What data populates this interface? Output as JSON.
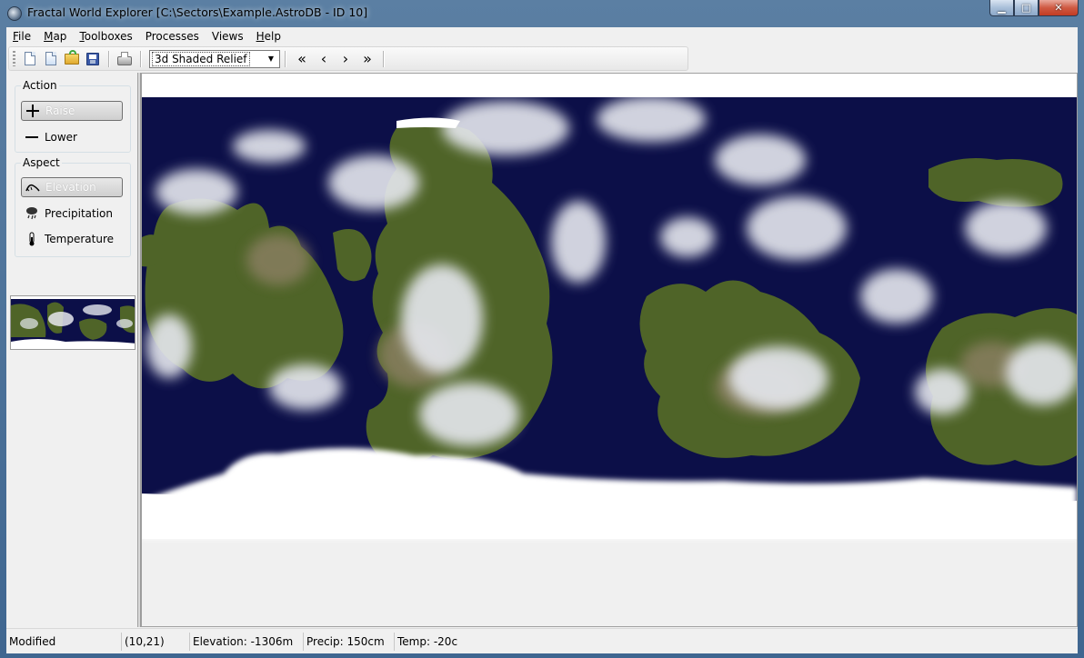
{
  "window": {
    "title": "Fractal World Explorer [C:\\Sectors\\Example.AstroDB - ID 10]",
    "controls": {
      "minimize": "▁",
      "maximize": "□",
      "close": "✕"
    }
  },
  "menu": {
    "items": [
      {
        "key": "F",
        "rest": "ile"
      },
      {
        "key": "M",
        "rest": "ap"
      },
      {
        "key": "T",
        "rest": "oolboxes"
      },
      {
        "key": "",
        "rest": "Processes"
      },
      {
        "key": "",
        "rest": "Views"
      },
      {
        "key": "H",
        "rest": "elp"
      }
    ]
  },
  "toolbar": {
    "view_select": {
      "value": "3d Shaded Relief"
    },
    "nav": {
      "first": "«",
      "prev": "‹",
      "next": "›",
      "last": "»"
    }
  },
  "left_panel": {
    "action_group": {
      "label": "Action",
      "raise": {
        "label": "Raise",
        "icon": "plus-icon",
        "active": true
      },
      "lower": {
        "label": "Lower",
        "icon": "minus-icon",
        "active": false
      }
    },
    "aspect_group": {
      "label": "Aspect",
      "elevation": {
        "label": "Elevation",
        "icon": "mountain-icon",
        "active": true
      },
      "precipitation": {
        "label": "Precipitation",
        "icon": "cloud-rain-icon",
        "active": false
      },
      "temperature": {
        "label": "Temperature",
        "icon": "thermometer-icon",
        "active": false
      }
    }
  },
  "colors": {
    "ocean": "#0c0f48",
    "land": "#4f6428",
    "desert": "#8c8064",
    "cloud": "#e6e8ef",
    "ice": "#ffffff"
  },
  "status": {
    "state": "Modified",
    "coords": "(10,21)",
    "elevation": "Elevation: -1306m",
    "precip": "Precip: 150cm",
    "temp": "Temp: -20c"
  }
}
